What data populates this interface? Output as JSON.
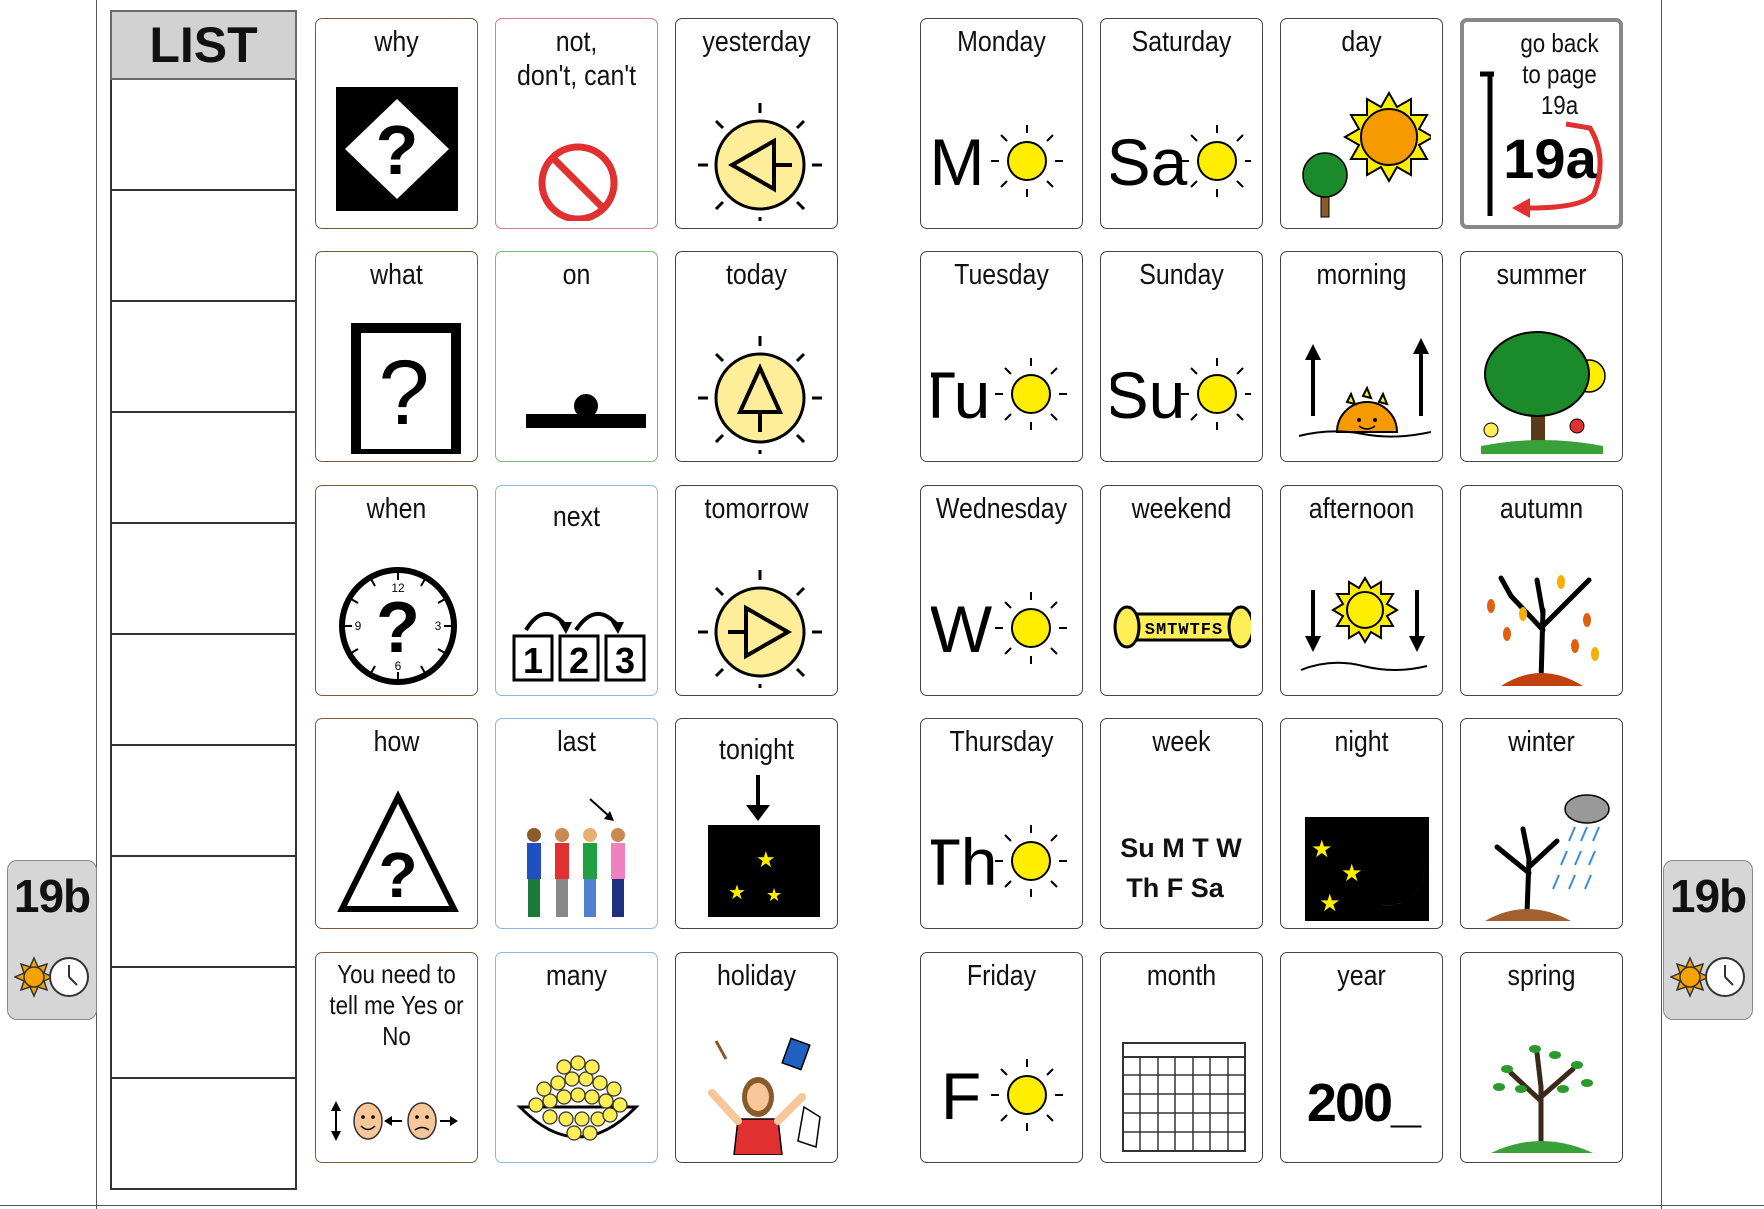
{
  "page_tab": {
    "label": "19b",
    "icons": [
      "sun-icon",
      "clock-icon"
    ]
  },
  "list": {
    "title": "LIST",
    "rows": 10
  },
  "cells": {
    "why": "why",
    "not": "not,\ndon't, can't",
    "yesterday": "yesterday",
    "what": "what",
    "on": "on",
    "today": "today",
    "when": "when",
    "next": "next",
    "tomorrow": "tomorrow",
    "how": "how",
    "last": "last",
    "tonight": "tonight",
    "you_need_to_tell": "You need to tell me Yes or No",
    "many": "many",
    "holiday": "holiday",
    "monday": "Monday",
    "saturday": "Saturday",
    "day": "day",
    "go_back": "go back to page 19a",
    "tuesday": "Tuesday",
    "sunday": "Sunday",
    "morning": "morning",
    "summer": "summer",
    "wednesday": "Wednesday",
    "weekend": "weekend",
    "afternoon": "afternoon",
    "autumn": "autumn",
    "thursday": "Thursday",
    "week": "week",
    "night": "night",
    "winter": "winter",
    "friday": "Friday",
    "month": "month",
    "year": "year",
    "spring": "spring"
  },
  "symbols": {
    "monday": "M",
    "saturday": "Sa",
    "tuesday": "Tu",
    "sunday": "Su",
    "wednesday": "W",
    "thursday": "Th",
    "friday": "F",
    "year": "200_",
    "go_back_page": "19a",
    "week_row1": "Su M T W",
    "week_row2": "Th F Sa",
    "weekend_letters": "SMTWTFS",
    "next_numbers": [
      "1",
      "2",
      "3"
    ],
    "clock_numbers": [
      "12",
      "3",
      "6",
      "9"
    ]
  },
  "colors": {
    "sun": "#ffee55",
    "sun_orange": "#f5a300",
    "tab_bg": "#d6d6d6"
  }
}
